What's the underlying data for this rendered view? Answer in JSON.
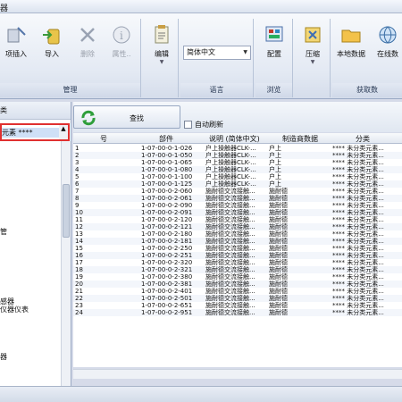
{
  "title": "器",
  "ribbon": {
    "groups": [
      {
        "label": "管理",
        "buttons": [
          {
            "label": "项插入",
            "icon": "insert-icon"
          },
          {
            "label": "导入",
            "icon": "import-icon"
          },
          {
            "label": "删除",
            "icon": "delete-icon",
            "disabled": true
          },
          {
            "label": "属性..",
            "icon": "properties-icon",
            "disabled": true
          }
        ]
      },
      {
        "label": "",
        "buttons": [
          {
            "label": "编辑",
            "icon": "edit-icon"
          }
        ]
      },
      {
        "label": "语言",
        "select_value": "简体中文"
      },
      {
        "label": "浏览",
        "buttons": [
          {
            "label": "配置",
            "icon": "config-icon"
          }
        ]
      },
      {
        "label": "",
        "buttons": [
          {
            "label": "压缩",
            "icon": "compress-icon"
          }
        ]
      },
      {
        "label": "获取数",
        "buttons": [
          {
            "label": "本地数据",
            "icon": "folder-icon"
          },
          {
            "label": "在线数",
            "icon": "online-icon"
          }
        ]
      }
    ]
  },
  "left": {
    "header": "类",
    "selected_item": "元素 ****",
    "items": [
      "管",
      "感器",
      "仪器仪表",
      "器"
    ]
  },
  "toolbar": {
    "find_label": "查找",
    "auto_refresh_label": "自动刷新"
  },
  "grid": {
    "headers": [
      "号",
      "部件",
      "说明 (简体中文)",
      "制造商数据",
      "分类"
    ],
    "rows": [
      [
        "1",
        "1-07-00-0-1-026",
        "户上操触器CLK-...",
        "户上",
        "**** 未分类元素..."
      ],
      [
        "2",
        "1-07-00-0-1-050",
        "户上操触器CLK-...",
        "户上",
        "**** 未分类元素..."
      ],
      [
        "3",
        "1-07-00-0-1-065",
        "户上操触器CLK-...",
        "户上",
        "**** 未分类元素..."
      ],
      [
        "4",
        "1-07-00-0-1-080",
        "户上操触器CLK-...",
        "户上",
        "**** 未分类元素..."
      ],
      [
        "5",
        "1-07-00-0-1-100",
        "户上操触器CLK-...",
        "户上",
        "**** 未分类元素..."
      ],
      [
        "6",
        "1-07-00-0-1-125",
        "户上操触器CLK-...",
        "户上",
        "**** 未分类元素..."
      ],
      [
        "7",
        "1-07-00-0-2-060",
        "施耐德交流接触...",
        "施耐德",
        "**** 未分类元素..."
      ],
      [
        "8",
        "1-07-00-0-2-061",
        "施耐德交流接触...",
        "施耐德",
        "**** 未分类元素..."
      ],
      [
        "9",
        "1-07-00-0-2-090",
        "施耐德交流接触...",
        "施耐德",
        "**** 未分类元素..."
      ],
      [
        "10",
        "1-07-00-0-2-091",
        "施耐德交流接触...",
        "施耐德",
        "**** 未分类元素..."
      ],
      [
        "11",
        "1-07-00-0-2-120",
        "施耐德交流接触...",
        "施耐德",
        "**** 未分类元素..."
      ],
      [
        "12",
        "1-07-00-0-2-121",
        "施耐德交流接触...",
        "施耐德",
        "**** 未分类元素..."
      ],
      [
        "13",
        "1-07-00-0-2-180",
        "施耐德交流接触...",
        "施耐德",
        "**** 未分类元素..."
      ],
      [
        "14",
        "1-07-00-0-2-181",
        "施耐德交流接触...",
        "施耐德",
        "**** 未分类元素..."
      ],
      [
        "15",
        "1-07-00-0-2-250",
        "施耐德交流接触...",
        "施耐德",
        "**** 未分类元素..."
      ],
      [
        "16",
        "1-07-00-0-2-251",
        "施耐德交流接触...",
        "施耐德",
        "**** 未分类元素..."
      ],
      [
        "17",
        "1-07-00-0-2-320",
        "施耐德交流接触...",
        "施耐德",
        "**** 未分类元素..."
      ],
      [
        "18",
        "1-07-00-0-2-321",
        "施耐德交流接触...",
        "施耐德",
        "**** 未分类元素..."
      ],
      [
        "19",
        "1-07-00-0-2-380",
        "施耐德交流接触...",
        "施耐德",
        "**** 未分类元素..."
      ],
      [
        "20",
        "1-07-00-0-2-381",
        "施耐德交流接触...",
        "施耐德",
        "**** 未分类元素..."
      ],
      [
        "21",
        "1-07-00-0-2-401",
        "施耐德交流接触...",
        "施耐德",
        "**** 未分类元素..."
      ],
      [
        "22",
        "1-07-00-0-2-501",
        "施耐德交流接触...",
        "施耐德",
        "**** 未分类元素..."
      ],
      [
        "23",
        "1-07-00-0-2-651",
        "施耐德交流接触...",
        "施耐德",
        "**** 未分类元素..."
      ],
      [
        "24",
        "1-07-00-0-2-951",
        "施耐德交流接触...",
        "施耐德",
        "**** 未分类元素..."
      ]
    ]
  }
}
